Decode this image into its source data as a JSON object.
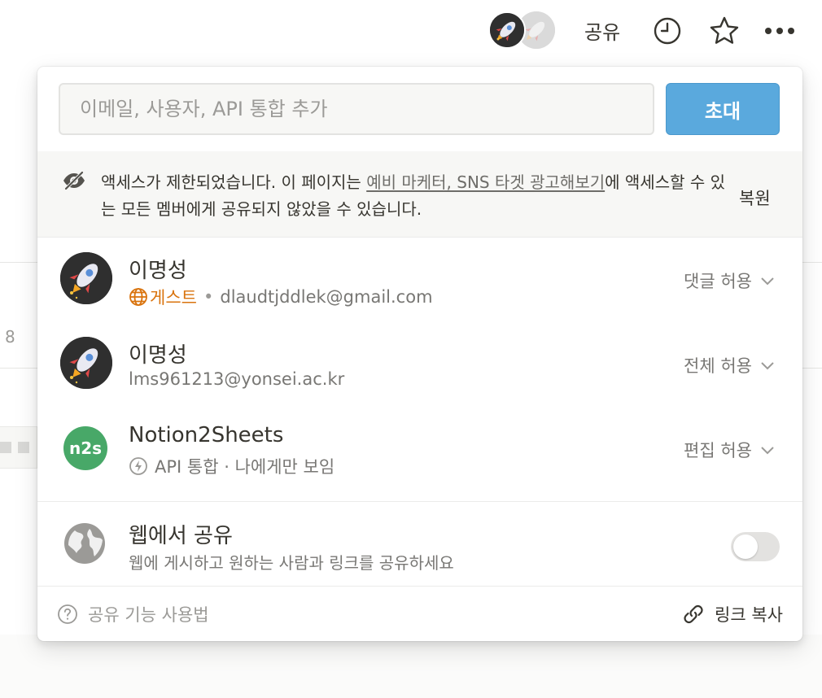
{
  "topbar": {
    "share_label": "공유"
  },
  "invite": {
    "placeholder": "이메일, 사용자, API 통합 추가",
    "button_label": "초대"
  },
  "notice": {
    "text_before": "액세스가 제한되었습니다. 이 페이지는 ",
    "link_text": "예비 마케터, SNS 타겟 광고해보기",
    "text_after": "에 액세스할 수 있는 모든 멤버에게 공유되지 않았을 수 있습니다.",
    "restore_label": "복원"
  },
  "members": [
    {
      "name": "이명성",
      "guest_label": "게스트",
      "email": "dlaudtjddlek@gmail.com",
      "permission": "댓글 허용"
    },
    {
      "name": "이명성",
      "email": "lms961213@yonsei.ac.kr",
      "permission": "전체 허용"
    },
    {
      "name": "Notion2Sheets",
      "avatar_text": "n2s",
      "integration_label": "API 통합 · 나에게만 보임",
      "permission": "편집 허용"
    }
  ],
  "web": {
    "title": "웹에서 공유",
    "subtitle": "웹에 게시하고 원하는 사람과 링크를 공유하세요",
    "enabled": false
  },
  "footer": {
    "help_label": "공유 기능 사용법",
    "copy_label": "링크 복사"
  },
  "background": {
    "row_number": "8"
  },
  "colors": {
    "accent": "#5aa9dd",
    "guest": "#d9730d",
    "n2s": "#48a868"
  }
}
